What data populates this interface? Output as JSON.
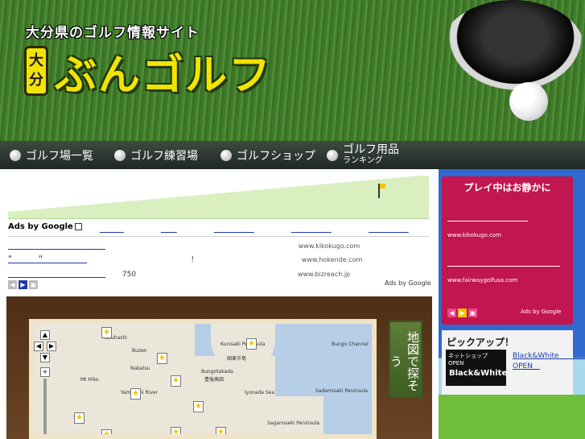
{
  "header": {
    "tagline": "大分県のゴルフ情報サイト",
    "logo_badge_top": "大",
    "logo_badge_bottom": "分",
    "logo_text": "ぶんゴルフ"
  },
  "nav": {
    "items": [
      {
        "label": "ゴルフ場一覧"
      },
      {
        "label": "ゴルフ練習場"
      },
      {
        "label": "ゴルフショップ"
      },
      {
        "label": "ゴルフ用品",
        "sub": "ランキング"
      }
    ]
  },
  "main": {
    "banner_title": "　　　　　　　　",
    "ads_by": "Ads by Google",
    "ad_links": [
      "　　　",
      "　　",
      "　　　　　",
      "　　　　　",
      "　　　　　"
    ],
    "ads": [
      {
        "title": "　　　　　　　　　　　",
        "desc": "　　　　　　　　　　　　　　　　　　　　　　　　　　",
        "url": "www.kikokugo.com"
      },
      {
        "title": "\"　　　\"　　　　　",
        "desc": "　　　　　　　　　　　　　　！　　　　　　　　　　　　　　",
        "url": "www.hokende.com"
      },
      {
        "title": "　　　　　　　　　　　",
        "desc": "　　750　　　　　　　　　　　　　　　　　　　　　　",
        "url": "www.bizreach.jp"
      }
    ],
    "ads_by_google_small": "Ads by Google",
    "map_title": "　　　　　　　　　　　",
    "map_labels": [
      "Buzen",
      "Yukuhashi",
      "Kunisaki\nPeninsula",
      "国東半島",
      "Bungotakada",
      "豊後高田",
      "Mt Hiko",
      "Nakatsu",
      "Yamakuni River",
      "Iyonada Sea",
      "Sadamisaki Peninsula",
      "Saganoseki Peninsula",
      "Bungo Channel"
    ],
    "map_search_label": "地図で探そう"
  },
  "sidebar": {
    "box_title": "プレイ中はお静かに",
    "ads": [
      {
        "title": "　　　　　　　　　　",
        "desc": "　　　　　　　　　　　　　　　　　　",
        "url": "www.kikokugo.com"
      },
      {
        "title": "　　　　　　　　　　　　　　",
        "desc": "　　　　　　",
        "url": "www.fairwaygolfusa.com"
      }
    ],
    "ads_by_google": "Ads by Google",
    "pickup_title": "ピックアップ！",
    "pickup_img_top": "ネットショップ OPEN",
    "pickup_img_brand": "Black&White",
    "pickup_text": "Black&White　　　　　　　　　　　　　OPEN　"
  },
  "colors": {
    "accent_yellow": "#f3e400",
    "sidebar_red": "#c11650",
    "link_blue": "#1b3aa8"
  }
}
